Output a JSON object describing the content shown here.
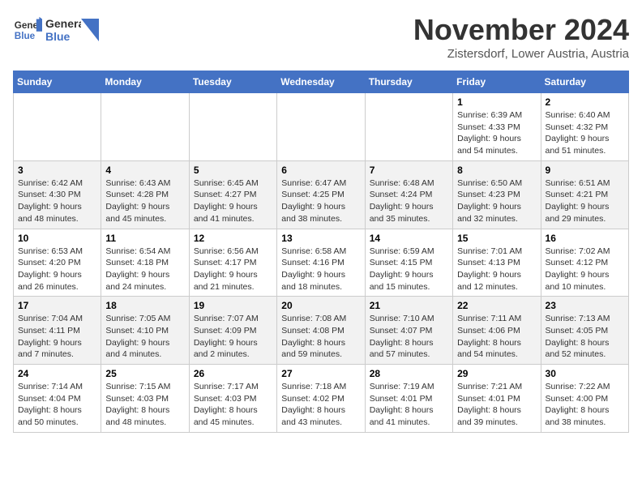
{
  "header": {
    "logo_line1": "General",
    "logo_line2": "Blue",
    "month_title": "November 2024",
    "location": "Zistersdorf, Lower Austria, Austria"
  },
  "weekdays": [
    "Sunday",
    "Monday",
    "Tuesday",
    "Wednesday",
    "Thursday",
    "Friday",
    "Saturday"
  ],
  "weeks": [
    [
      {
        "day": "",
        "info": ""
      },
      {
        "day": "",
        "info": ""
      },
      {
        "day": "",
        "info": ""
      },
      {
        "day": "",
        "info": ""
      },
      {
        "day": "",
        "info": ""
      },
      {
        "day": "1",
        "info": "Sunrise: 6:39 AM\nSunset: 4:33 PM\nDaylight: 9 hours\nand 54 minutes."
      },
      {
        "day": "2",
        "info": "Sunrise: 6:40 AM\nSunset: 4:32 PM\nDaylight: 9 hours\nand 51 minutes."
      }
    ],
    [
      {
        "day": "3",
        "info": "Sunrise: 6:42 AM\nSunset: 4:30 PM\nDaylight: 9 hours\nand 48 minutes."
      },
      {
        "day": "4",
        "info": "Sunrise: 6:43 AM\nSunset: 4:28 PM\nDaylight: 9 hours\nand 45 minutes."
      },
      {
        "day": "5",
        "info": "Sunrise: 6:45 AM\nSunset: 4:27 PM\nDaylight: 9 hours\nand 41 minutes."
      },
      {
        "day": "6",
        "info": "Sunrise: 6:47 AM\nSunset: 4:25 PM\nDaylight: 9 hours\nand 38 minutes."
      },
      {
        "day": "7",
        "info": "Sunrise: 6:48 AM\nSunset: 4:24 PM\nDaylight: 9 hours\nand 35 minutes."
      },
      {
        "day": "8",
        "info": "Sunrise: 6:50 AM\nSunset: 4:23 PM\nDaylight: 9 hours\nand 32 minutes."
      },
      {
        "day": "9",
        "info": "Sunrise: 6:51 AM\nSunset: 4:21 PM\nDaylight: 9 hours\nand 29 minutes."
      }
    ],
    [
      {
        "day": "10",
        "info": "Sunrise: 6:53 AM\nSunset: 4:20 PM\nDaylight: 9 hours\nand 26 minutes."
      },
      {
        "day": "11",
        "info": "Sunrise: 6:54 AM\nSunset: 4:18 PM\nDaylight: 9 hours\nand 24 minutes."
      },
      {
        "day": "12",
        "info": "Sunrise: 6:56 AM\nSunset: 4:17 PM\nDaylight: 9 hours\nand 21 minutes."
      },
      {
        "day": "13",
        "info": "Sunrise: 6:58 AM\nSunset: 4:16 PM\nDaylight: 9 hours\nand 18 minutes."
      },
      {
        "day": "14",
        "info": "Sunrise: 6:59 AM\nSunset: 4:15 PM\nDaylight: 9 hours\nand 15 minutes."
      },
      {
        "day": "15",
        "info": "Sunrise: 7:01 AM\nSunset: 4:13 PM\nDaylight: 9 hours\nand 12 minutes."
      },
      {
        "day": "16",
        "info": "Sunrise: 7:02 AM\nSunset: 4:12 PM\nDaylight: 9 hours\nand 10 minutes."
      }
    ],
    [
      {
        "day": "17",
        "info": "Sunrise: 7:04 AM\nSunset: 4:11 PM\nDaylight: 9 hours\nand 7 minutes."
      },
      {
        "day": "18",
        "info": "Sunrise: 7:05 AM\nSunset: 4:10 PM\nDaylight: 9 hours\nand 4 minutes."
      },
      {
        "day": "19",
        "info": "Sunrise: 7:07 AM\nSunset: 4:09 PM\nDaylight: 9 hours\nand 2 minutes."
      },
      {
        "day": "20",
        "info": "Sunrise: 7:08 AM\nSunset: 4:08 PM\nDaylight: 8 hours\nand 59 minutes."
      },
      {
        "day": "21",
        "info": "Sunrise: 7:10 AM\nSunset: 4:07 PM\nDaylight: 8 hours\nand 57 minutes."
      },
      {
        "day": "22",
        "info": "Sunrise: 7:11 AM\nSunset: 4:06 PM\nDaylight: 8 hours\nand 54 minutes."
      },
      {
        "day": "23",
        "info": "Sunrise: 7:13 AM\nSunset: 4:05 PM\nDaylight: 8 hours\nand 52 minutes."
      }
    ],
    [
      {
        "day": "24",
        "info": "Sunrise: 7:14 AM\nSunset: 4:04 PM\nDaylight: 8 hours\nand 50 minutes."
      },
      {
        "day": "25",
        "info": "Sunrise: 7:15 AM\nSunset: 4:03 PM\nDaylight: 8 hours\nand 48 minutes."
      },
      {
        "day": "26",
        "info": "Sunrise: 7:17 AM\nSunset: 4:03 PM\nDaylight: 8 hours\nand 45 minutes."
      },
      {
        "day": "27",
        "info": "Sunrise: 7:18 AM\nSunset: 4:02 PM\nDaylight: 8 hours\nand 43 minutes."
      },
      {
        "day": "28",
        "info": "Sunrise: 7:19 AM\nSunset: 4:01 PM\nDaylight: 8 hours\nand 41 minutes."
      },
      {
        "day": "29",
        "info": "Sunrise: 7:21 AM\nSunset: 4:01 PM\nDaylight: 8 hours\nand 39 minutes."
      },
      {
        "day": "30",
        "info": "Sunrise: 7:22 AM\nSunset: 4:00 PM\nDaylight: 8 hours\nand 38 minutes."
      }
    ]
  ]
}
